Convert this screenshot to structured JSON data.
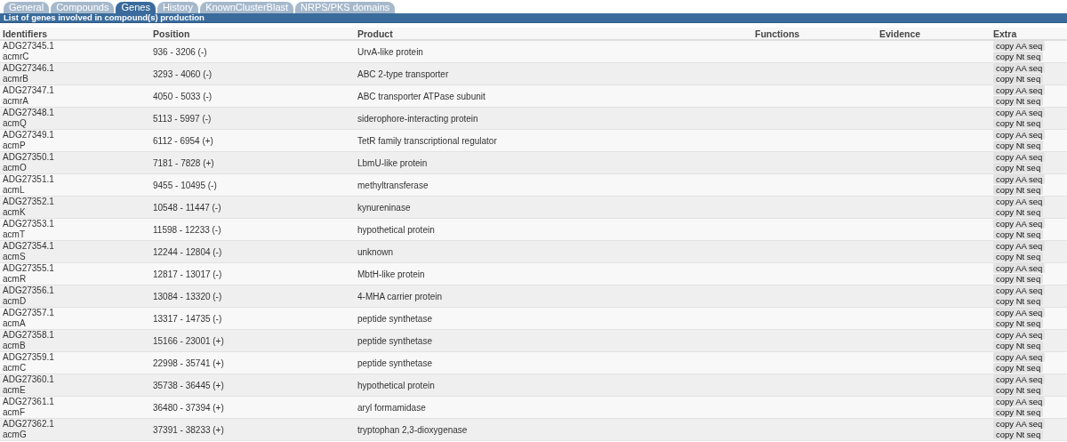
{
  "tabs": [
    {
      "label": "General",
      "selected": false
    },
    {
      "label": "Compounds",
      "selected": false
    },
    {
      "label": "Genes",
      "selected": true
    },
    {
      "label": "History",
      "selected": false
    },
    {
      "label": "KnownClusterBlast",
      "selected": false
    },
    {
      "label": "NRPS/PKS domains",
      "selected": false
    }
  ],
  "section_title": "List of genes involved in compound(s) production",
  "table": {
    "columns": [
      "Identifiers",
      "Position",
      "Product",
      "Functions",
      "Evidence",
      "Extra"
    ],
    "rows": [
      {
        "accession": "ADG27345.1",
        "gene": "acmrC",
        "position": "936 - 3206 (-)",
        "product": "UrvA-like protein",
        "buttons": [
          "copy AA seq",
          "copy Nt seq"
        ]
      },
      {
        "accession": "ADG27346.1",
        "gene": "acmrB",
        "position": "3293 - 4060 (-)",
        "product": "ABC 2-type transporter",
        "buttons": [
          "copy AA seq",
          "copy Nt seq"
        ]
      },
      {
        "accession": "ADG27347.1",
        "gene": "acmrA",
        "position": "4050 - 5033 (-)",
        "product": "ABC transporter ATPase subunit",
        "buttons": [
          "copy AA seq",
          "copy Nt seq"
        ]
      },
      {
        "accession": "ADG27348.1",
        "gene": "acmQ",
        "position": "5113 - 5997 (-)",
        "product": "siderophore-interacting protein",
        "buttons": [
          "copy AA seq",
          "copy Nt seq"
        ]
      },
      {
        "accession": "ADG27349.1",
        "gene": "acmP",
        "position": "6112 - 6954 (+)",
        "product": "TetR family transcriptional regulator",
        "buttons": [
          "copy AA seq",
          "copy Nt seq"
        ]
      },
      {
        "accession": "ADG27350.1",
        "gene": "acmO",
        "position": "7181 - 7828 (+)",
        "product": "LbmU-like protein",
        "buttons": [
          "copy AA seq",
          "copy Nt seq"
        ]
      },
      {
        "accession": "ADG27351.1",
        "gene": "acmL",
        "position": "9455 - 10495 (-)",
        "product": "methyltransferase",
        "buttons": [
          "copy AA seq",
          "copy Nt seq"
        ]
      },
      {
        "accession": "ADG27352.1",
        "gene": "acmK",
        "position": "10548 - 11447 (-)",
        "product": "kynureninase",
        "buttons": [
          "copy AA seq",
          "copy Nt seq"
        ]
      },
      {
        "accession": "ADG27353.1",
        "gene": "acmT",
        "position": "11598 - 12233 (-)",
        "product": "hypothetical protein",
        "buttons": [
          "copy AA seq",
          "copy Nt seq"
        ]
      },
      {
        "accession": "ADG27354.1",
        "gene": "acmS",
        "position": "12244 - 12804 (-)",
        "product": "unknown",
        "buttons": [
          "copy AA seq",
          "copy Nt seq"
        ]
      },
      {
        "accession": "ADG27355.1",
        "gene": "acmR",
        "position": "12817 - 13017 (-)",
        "product": "MbtH-like protein",
        "buttons": [
          "copy AA seq",
          "copy Nt seq"
        ]
      },
      {
        "accession": "ADG27356.1",
        "gene": "acmD",
        "position": "13084 - 13320 (-)",
        "product": "4-MHA carrier protein",
        "buttons": [
          "copy AA seq",
          "copy Nt seq"
        ]
      },
      {
        "accession": "ADG27357.1",
        "gene": "acmA",
        "position": "13317 - 14735 (-)",
        "product": "peptide synthetase",
        "buttons": [
          "copy AA seq",
          "copy Nt seq"
        ]
      },
      {
        "accession": "ADG27358.1",
        "gene": "acmB",
        "position": "15166 - 23001 (+)",
        "product": "peptide synthetase",
        "buttons": [
          "copy AA seq",
          "copy Nt seq"
        ]
      },
      {
        "accession": "ADG27359.1",
        "gene": "acmC",
        "position": "22998 - 35741 (+)",
        "product": "peptide synthetase",
        "buttons": [
          "copy AA seq",
          "copy Nt seq"
        ]
      },
      {
        "accession": "ADG27360.1",
        "gene": "acmE",
        "position": "35738 - 36445 (+)",
        "product": "hypothetical protein",
        "buttons": [
          "copy AA seq",
          "copy Nt seq"
        ]
      },
      {
        "accession": "ADG27361.1",
        "gene": "acmF",
        "position": "36480 - 37394 (+)",
        "product": "aryl formamidase",
        "buttons": [
          "copy AA seq",
          "copy Nt seq"
        ]
      },
      {
        "accession": "ADG27362.1",
        "gene": "acmG",
        "position": "37391 - 38233 (+)",
        "product": "tryptophan 2,3-dioxygenase",
        "buttons": [
          "copy AA seq",
          "copy Nt seq"
        ]
      }
    ]
  }
}
